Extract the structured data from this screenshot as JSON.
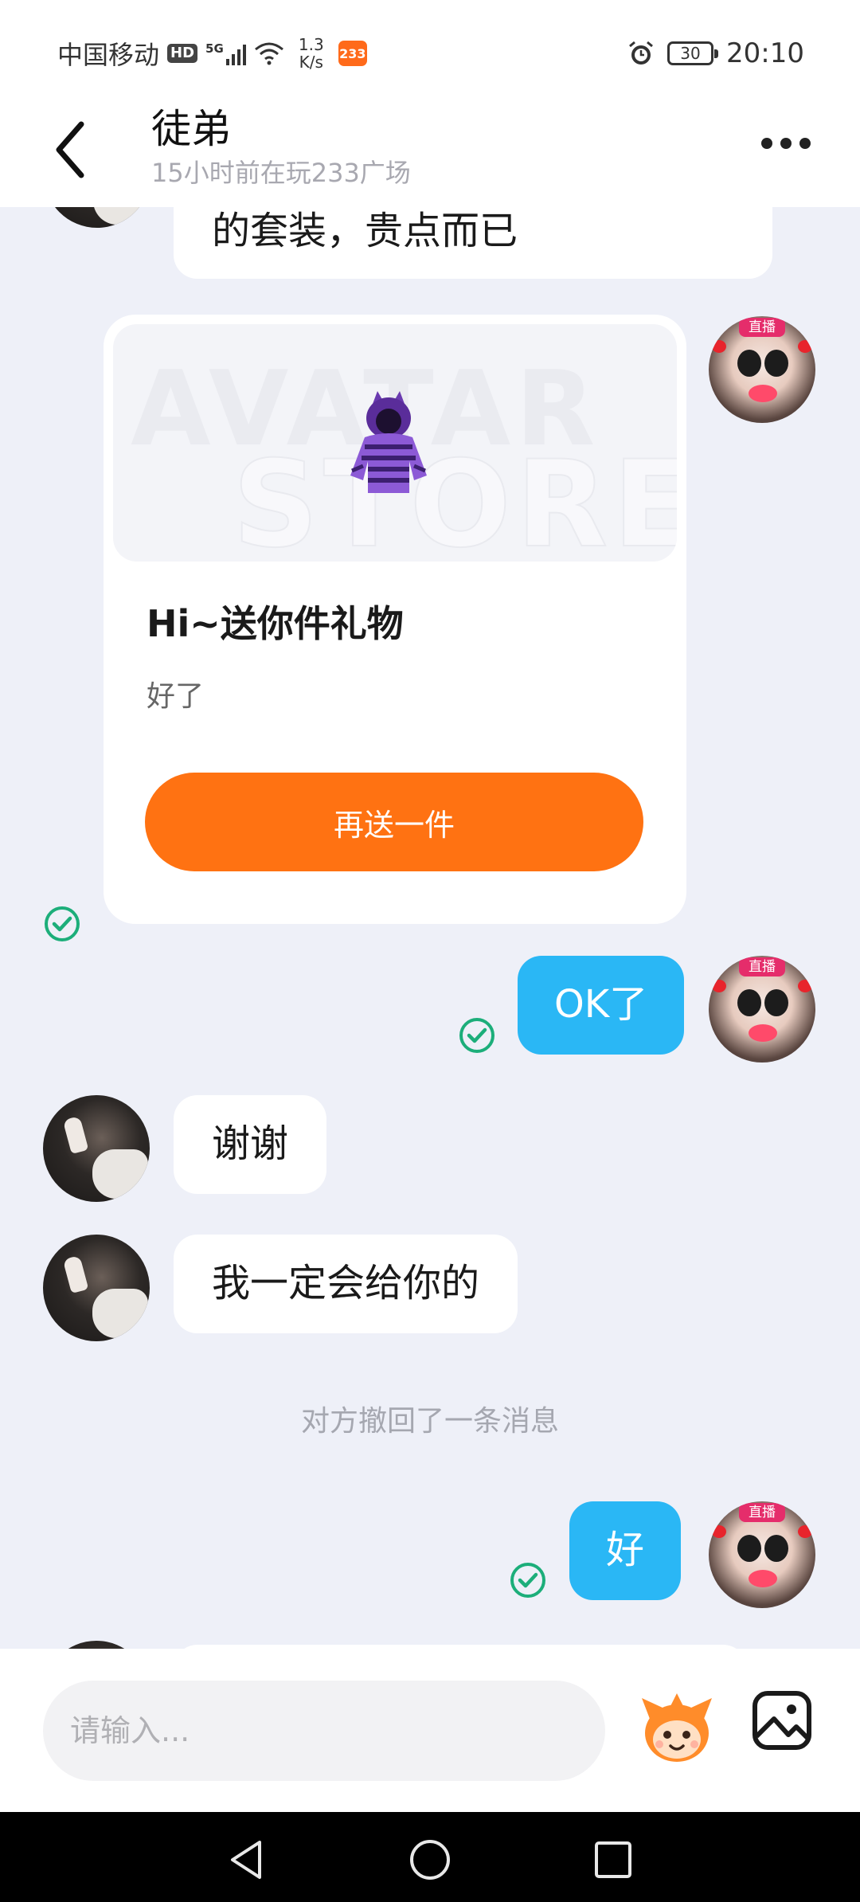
{
  "status_bar": {
    "carrier": "中国移动",
    "hd": "HD",
    "network": "5G",
    "speed_value": "1.3",
    "speed_unit": "K/s",
    "app_badge": "233",
    "battery": "30",
    "time": "20:10"
  },
  "header": {
    "title": "徒弟",
    "subtitle": "15小时前在玩233广场"
  },
  "chat": {
    "live_badge": "直播",
    "top_partial_message": "的套装，贵点而已",
    "gift_card": {
      "title": "Hi~送你件礼物",
      "description": "好了",
      "button_label": "再送一件",
      "watermark_line1": "AVATAR",
      "watermark_line2": "STORE"
    },
    "messages": [
      {
        "from": "me",
        "text": "OK了",
        "read": true
      },
      {
        "from": "other",
        "text": "谢谢"
      },
      {
        "from": "other",
        "text": "我一定会给你的"
      },
      {
        "from": "me",
        "text": "好",
        "read": true
      }
    ],
    "system_message": "对方撤回了一条消息"
  },
  "input_bar": {
    "placeholder": "请输入..."
  },
  "colors": {
    "accent_blue": "#2ab7f5",
    "accent_orange": "#ff7212",
    "check_green": "#1cae7a"
  }
}
